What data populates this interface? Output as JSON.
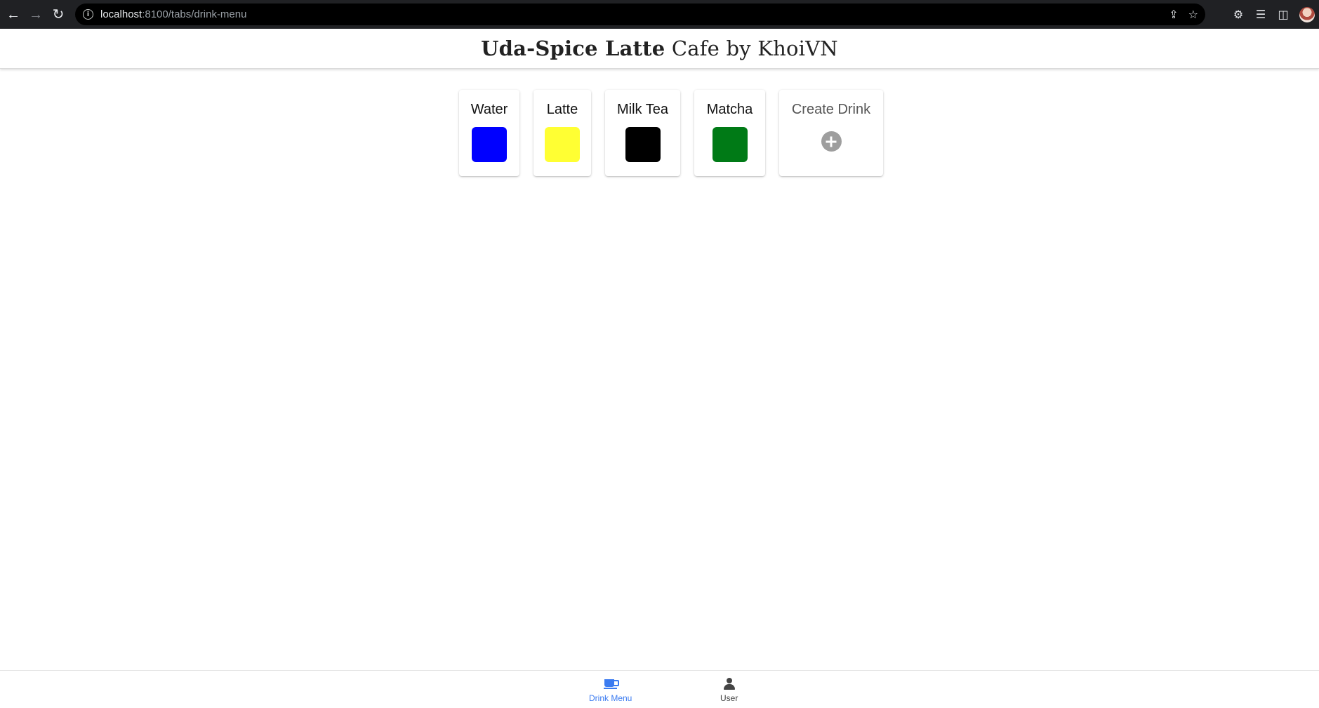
{
  "browser": {
    "url_host": "localhost",
    "url_path": ":8100/tabs/drink-menu",
    "icons": {
      "back": "arrow-back-icon",
      "forward": "arrow-forward-icon",
      "reload": "reload-icon",
      "info": "info-icon",
      "share": "share-icon",
      "bookmark": "star-icon",
      "extensions": "puzzle-icon",
      "media": "playlist-icon",
      "sidepanel": "side-panel-icon",
      "profile": "profile-avatar"
    }
  },
  "header": {
    "title_bold": "Uda-Spice Latte",
    "title_rest": " Cafe by KhoiVN"
  },
  "drinks": [
    {
      "name": "Water",
      "color": "#0000ff"
    },
    {
      "name": "Latte",
      "color": "#ffff33"
    },
    {
      "name": "Milk Tea",
      "color": "#000000"
    },
    {
      "name": "Matcha",
      "color": "#007a16"
    }
  ],
  "create_card": {
    "label": "Create Drink",
    "icon": "add-circle-icon"
  },
  "tabs": [
    {
      "label": "Drink Menu",
      "icon": "cup-icon",
      "active": true,
      "color": "#3b7bf0"
    },
    {
      "label": "User",
      "icon": "person-icon",
      "active": false,
      "color": "#444444"
    }
  ]
}
